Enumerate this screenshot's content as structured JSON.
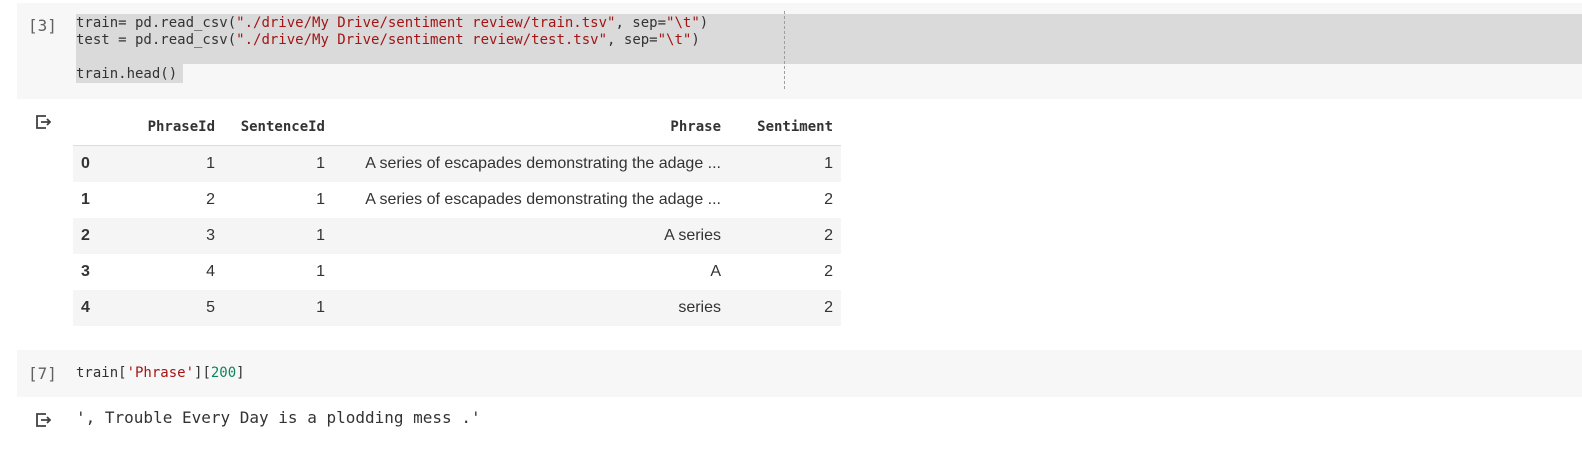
{
  "cells": [
    {
      "exec_count": "[3]",
      "code": {
        "line1_a": "train= pd.read_csv(",
        "line1_str1": "\"./drive/My Drive/sentiment review/train.tsv\"",
        "line1_b": ", sep=",
        "line1_str2": "\"\\t\"",
        "line1_c": ")",
        "line2_a": "test = pd.read_csv(",
        "line2_str1": "\"./drive/My Drive/sentiment review/test.tsv\"",
        "line2_b": ", sep=",
        "line2_str2": "\"\\t\"",
        "line2_c": ")",
        "line4": "train.head()"
      },
      "output_table": {
        "columns": [
          "PhraseId",
          "SentenceId",
          "Phrase",
          "Sentiment"
        ],
        "rows": [
          {
            "index": "0",
            "PhraseId": "1",
            "SentenceId": "1",
            "Phrase": "A series of escapades demonstrating the adage ...",
            "Sentiment": "1"
          },
          {
            "index": "1",
            "PhraseId": "2",
            "SentenceId": "1",
            "Phrase": "A series of escapades demonstrating the adage ...",
            "Sentiment": "2"
          },
          {
            "index": "2",
            "PhraseId": "3",
            "SentenceId": "1",
            "Phrase": "A series",
            "Sentiment": "2"
          },
          {
            "index": "3",
            "PhraseId": "4",
            "SentenceId": "1",
            "Phrase": "A",
            "Sentiment": "2"
          },
          {
            "index": "4",
            "PhraseId": "5",
            "SentenceId": "1",
            "Phrase": "series",
            "Sentiment": "2"
          }
        ]
      }
    },
    {
      "exec_count": "[7]",
      "code": {
        "a": "train[",
        "str": "'Phrase'",
        "b": "][",
        "num": "200",
        "c": "]"
      },
      "output_text": "', Trouble Every Day is a plodding mess .'"
    }
  ],
  "icons": {
    "output": "output-arrow-icon"
  },
  "colors": {
    "cell_bg": "#f7f7f7",
    "selection": "#dadada",
    "string": "#a31515",
    "number": "#09885a"
  }
}
